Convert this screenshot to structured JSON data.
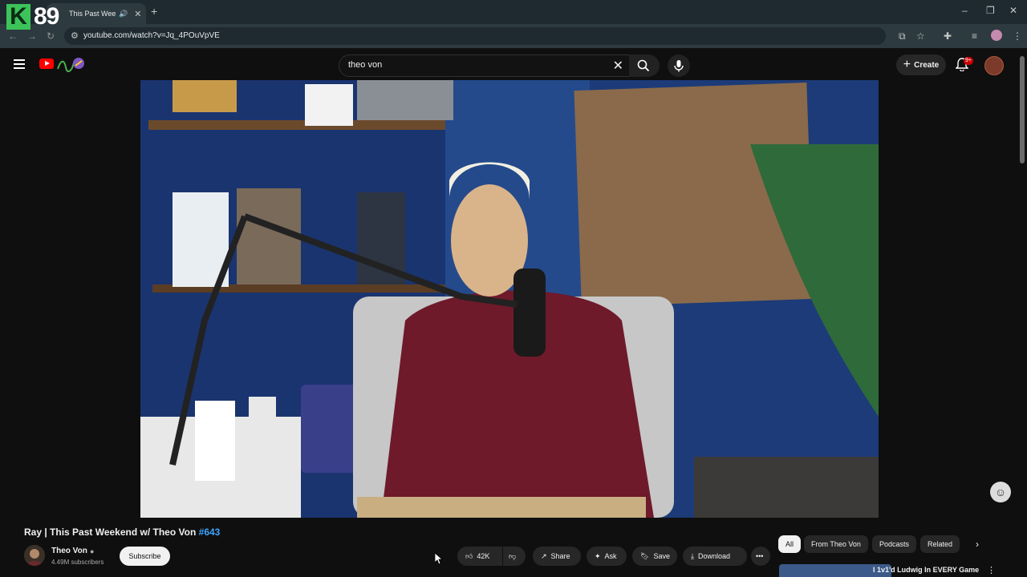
{
  "browser": {
    "tab_title": "This Past Weeke",
    "url": "youtube.com/watch?v=Jq_4POuVpVE",
    "overlay_logo_text": "89"
  },
  "header": {
    "search_query": "theo von",
    "create_label": "Create",
    "notification_badge": "9+"
  },
  "video": {
    "title": "Ray | This Past Weekend w/ Theo Von",
    "hashtag": "#643"
  },
  "channel": {
    "name": "Theo Von",
    "subscribers": "4.49M subscribers",
    "subscribe_label": "Subscribe"
  },
  "actions": {
    "like_count": "42K",
    "share_label": "Share",
    "ask_label": "Ask",
    "save_label": "Save",
    "download_label": "Download"
  },
  "chips": [
    "All",
    "From Theo Von",
    "Podcasts",
    "Related"
  ],
  "recommendation": {
    "title": "I 1v1'd Ludwig In EVERY Game"
  },
  "colors": {
    "accent": "#3ea6ff",
    "youtube_red": "#ff0000",
    "background": "#0f0f0f"
  }
}
